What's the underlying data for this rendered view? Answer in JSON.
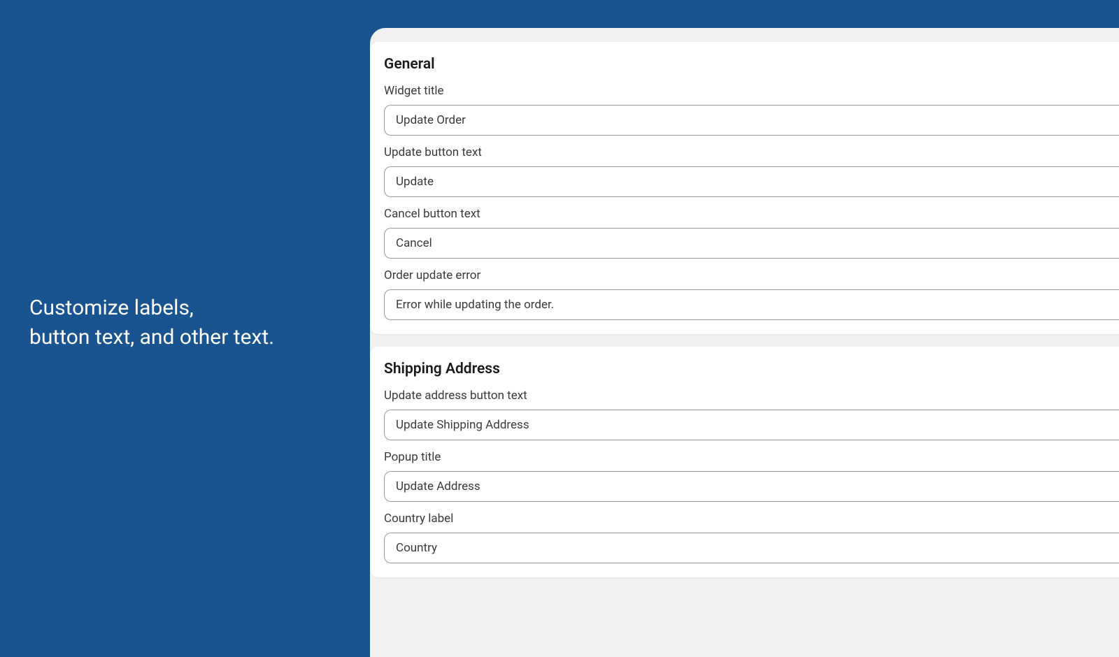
{
  "marketing": {
    "line1": "Customize labels,",
    "line2": "button text, and other text."
  },
  "sections": {
    "general": {
      "title": "General",
      "fields": {
        "widget_title": {
          "label": "Widget title",
          "value": "Update Order"
        },
        "update_button_text": {
          "label": "Update button text",
          "value": "Update"
        },
        "cancel_button_text": {
          "label": "Cancel button text",
          "value": "Cancel"
        },
        "order_update_error": {
          "label": "Order update error",
          "value": "Error while updating the order."
        }
      }
    },
    "shipping": {
      "title": "Shipping Address",
      "fields": {
        "update_address_button_text": {
          "label": "Update address button text",
          "value": "Update Shipping Address"
        },
        "popup_title": {
          "label": "Popup title",
          "value": "Update Address"
        },
        "country_label": {
          "label": "Country label",
          "value": "Country"
        }
      }
    }
  }
}
